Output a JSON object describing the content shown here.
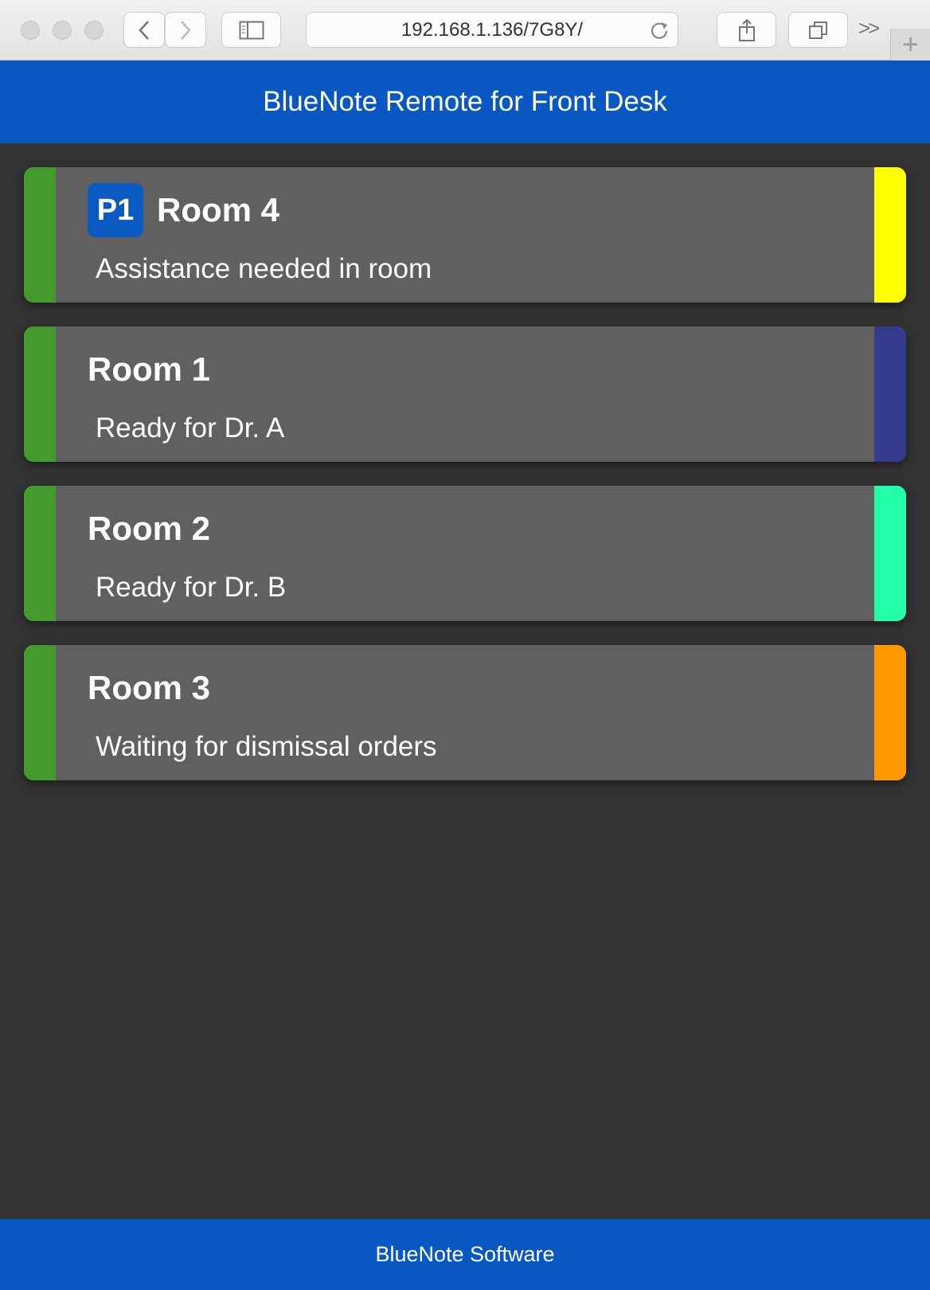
{
  "browser": {
    "url": "192.168.1.136/7G8Y/",
    "overflow_label": ">>",
    "new_tab_label": "+"
  },
  "header": {
    "title": "BlueNote Remote for Front Desk"
  },
  "rooms": [
    {
      "badge": "P1",
      "name": "Room 4",
      "message": "Assistance needed in room",
      "left_color": "#459a2e",
      "right_color": "#ffff00"
    },
    {
      "badge": "",
      "name": "Room 1",
      "message": "Ready for Dr. A",
      "left_color": "#459a2e",
      "right_color": "#343a8e"
    },
    {
      "badge": "",
      "name": "Room 2",
      "message": "Ready for Dr. B",
      "left_color": "#459a2e",
      "right_color": "#22ffa6"
    },
    {
      "badge": "",
      "name": "Room 3",
      "message": "Waiting for dismissal orders",
      "left_color": "#459a2e",
      "right_color": "#ff9900"
    }
  ],
  "footer": {
    "text": "BlueNote Software"
  },
  "colors": {
    "brand_blue": "#0857c3",
    "background": "#333333",
    "card": "#606060"
  }
}
